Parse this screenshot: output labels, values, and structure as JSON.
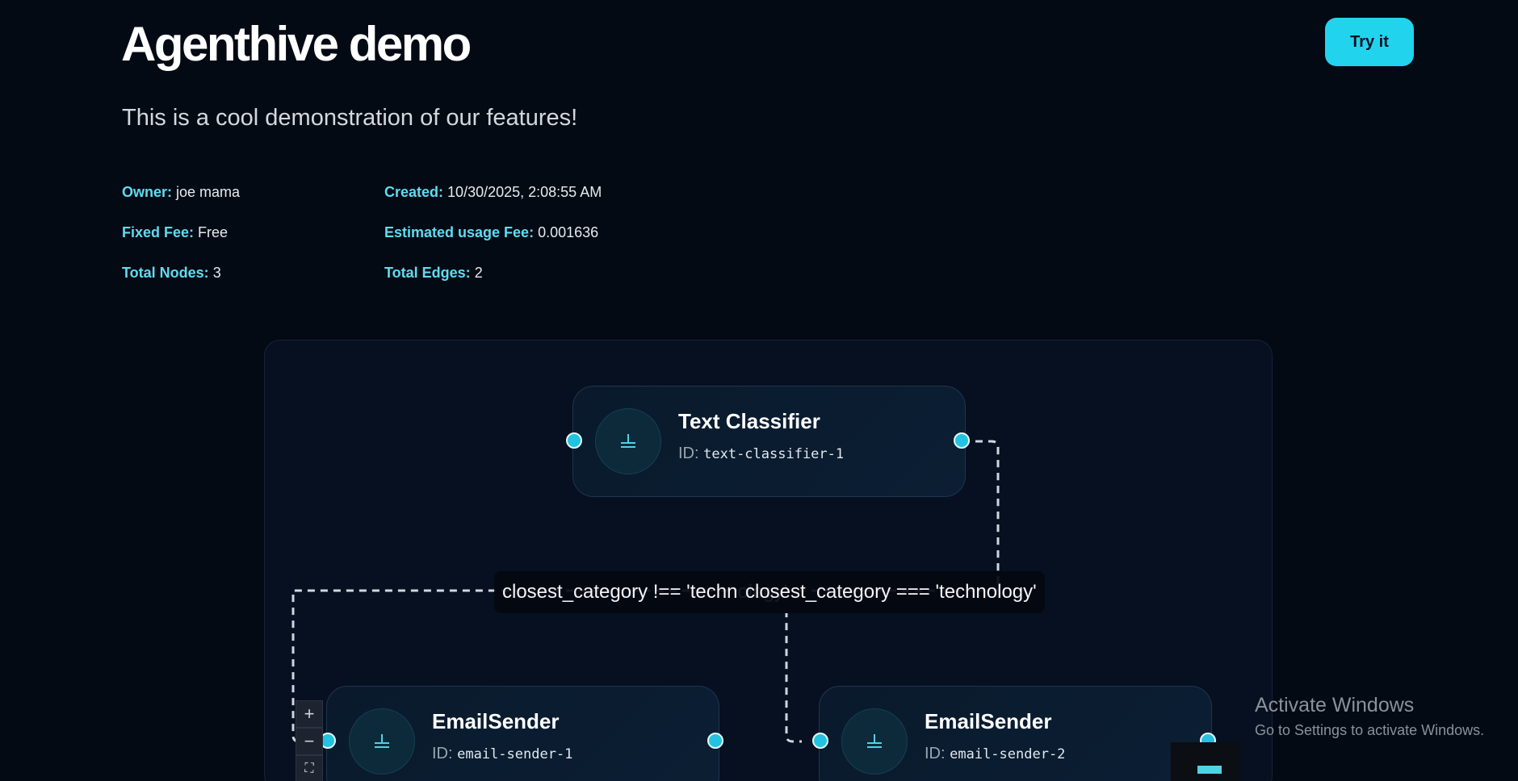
{
  "header": {
    "title": "Agenthive demo",
    "subtitle": "This is a cool demonstration of our features!",
    "try_button": "Try it"
  },
  "meta": {
    "owner_label": "Owner:",
    "owner": "joe mama",
    "created_label": "Created:",
    "created": "10/30/2025, 2:08:55 AM",
    "fixed_fee_label": "Fixed Fee:",
    "fixed_fee": "Free",
    "usage_fee_label": "Estimated usage Fee:",
    "usage_fee": "0.001636",
    "total_nodes_label": "Total Nodes:",
    "total_nodes": "3",
    "total_edges_label": "Total Edges:",
    "total_edges": "2"
  },
  "flow": {
    "nodes": [
      {
        "title": "Text Classifier",
        "id_label": "ID:",
        "id": "text-classifier-1"
      },
      {
        "title": "EmailSender",
        "id_label": "ID:",
        "id": "email-sender-1"
      },
      {
        "title": "EmailSender",
        "id_label": "ID:",
        "id": "email-sender-2"
      }
    ],
    "edges": [
      {
        "label": "closest_category !== 'technology'"
      },
      {
        "label": "closest_category === 'technology'"
      }
    ],
    "controls": {
      "zoom_in": "+",
      "zoom_out": "−",
      "fit": "⛶"
    }
  },
  "os_watermark": {
    "title": "Activate Windows",
    "subtitle": "Go to Settings to activate Windows."
  },
  "colors": {
    "background": "#040a14",
    "accent": "#22d3ee",
    "label_accent": "#5fdcf0",
    "node_border": "#1e3550"
  },
  "icons": {
    "node_icon": "ground-symbol-icon",
    "fit_view": "fit-view-icon"
  }
}
